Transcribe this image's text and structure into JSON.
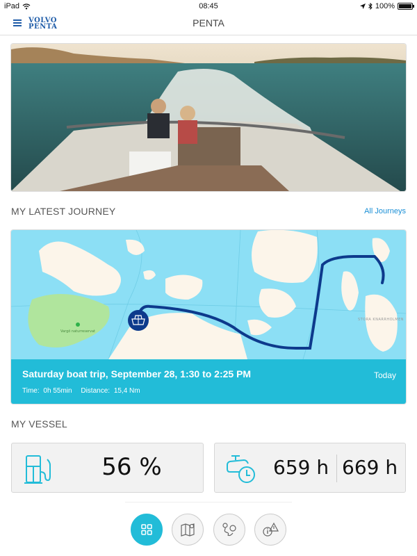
{
  "status_bar": {
    "device": "iPad",
    "time": "08:45",
    "battery": "100%"
  },
  "nav": {
    "logo_line1": "VOLVO",
    "logo_line2": "PENTA",
    "title": "PENTA"
  },
  "hero": {
    "alt": "Boat speeding across water with passengers"
  },
  "journey_section": {
    "title": "MY LATEST JOURNEY",
    "link": "All Journeys",
    "card": {
      "title": "Saturday boat trip, September 28, 1:30 to 2:25 PM",
      "date": "Today",
      "time_label": "Time:",
      "time_value": "0h  55min",
      "distance_label": "Distance:",
      "distance_value": "15,4 Nm"
    },
    "map_labels": {
      "reserve": "Vargö naturreservat",
      "island": "STORA KNARRHOLMEN"
    }
  },
  "vessel_section": {
    "title": "MY VESSEL",
    "fuel": {
      "icon": "fuel-pump-icon",
      "value": "56 %",
      "percent": 56
    },
    "engine_hours": {
      "icon": "engine-clock-icon",
      "engine1": "659 h",
      "engine2": "669 h"
    }
  },
  "tabs": [
    {
      "name": "dashboard",
      "icon": "grid-icon",
      "active": true
    },
    {
      "name": "map",
      "icon": "map-icon",
      "active": false
    },
    {
      "name": "journeys",
      "icon": "route-icon",
      "active": false
    },
    {
      "name": "alerts",
      "icon": "info-warning-icon",
      "active": false
    }
  ],
  "colors": {
    "accent": "#22bcd8",
    "brand": "#1f5ca8",
    "route": "#0d3a8c",
    "link": "#1a8fd6"
  }
}
